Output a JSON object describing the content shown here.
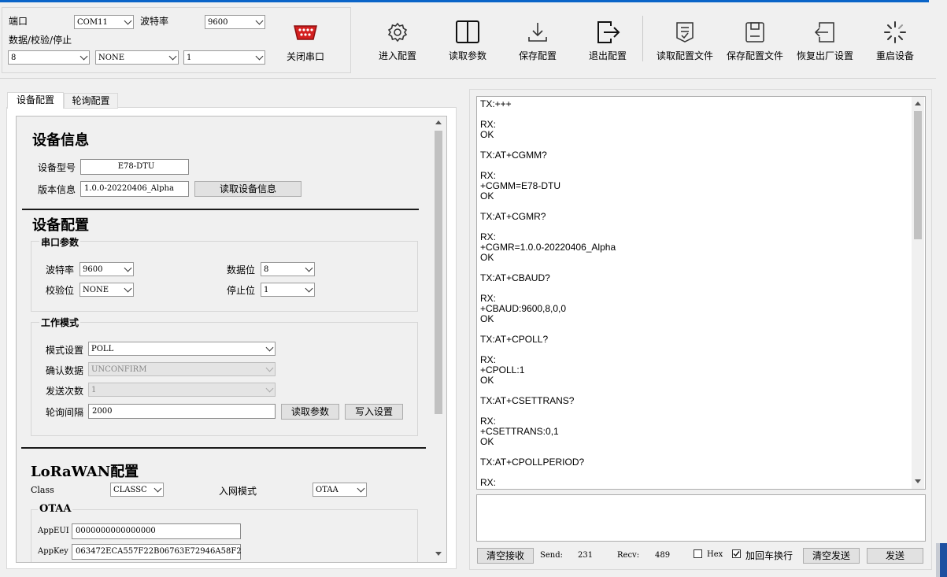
{
  "serial": {
    "port_label": "端口",
    "port_value": "COM11",
    "baud_label": "波特率",
    "baud_value": "9600",
    "dps_label": "数据/校验/停止",
    "data_value": "8",
    "parity_value": "NONE",
    "stop_value": "1",
    "close_label": "关闭串口"
  },
  "toolbar": {
    "enter_config": "进入配置",
    "read_params": "读取参数",
    "save_config": "保存配置",
    "exit_config": "退出配置",
    "read_config_file": "读取配置文件",
    "save_config_file": "保存配置文件",
    "factory_reset": "恢复出厂设置",
    "restart": "重启设备"
  },
  "tabs": {
    "device_config": "设备配置",
    "poll_config": "轮询配置"
  },
  "device_info": {
    "title": "设备信息",
    "model_label": "设备型号",
    "model_value": "E78-DTU",
    "version_label": "版本信息",
    "version_value": "1.0.0-20220406_Alpha",
    "read_info_button": "读取设备信息"
  },
  "device_config": {
    "title": "设备配置",
    "serial_params_title": "串口参数",
    "baud_label": "波特率",
    "baud_value": "9600",
    "databits_label": "数据位",
    "databits_value": "8",
    "parity_label": "校验位",
    "parity_value": "NONE",
    "stopbits_label": "停止位",
    "stopbits_value": "1",
    "work_mode_title": "工作模式",
    "mode_label": "模式设置",
    "mode_value": "POLL",
    "confirm_label": "确认数据",
    "confirm_value": "UNCONFIRM",
    "send_count_label": "发送次数",
    "send_count_value": "1",
    "poll_interval_label": "轮询间隔",
    "poll_interval_value": "2000",
    "read_params_button": "读取参数",
    "write_settings_button": "写入设置"
  },
  "lorawan": {
    "title": "LoRaWAN配置",
    "class_label": "Class",
    "class_value": "CLASSC",
    "join_label": "入网模式",
    "join_value": "OTAA",
    "otaa_title": "OTAA",
    "appeui_label": "AppEUI",
    "appeui_value": "0000000000000000",
    "appkey_label": "AppKey",
    "appkey_value": "063472ECA557F22B06763E72946A58F2"
  },
  "log_text": "TX:+++\n\nRX:\nOK\n\nTX:AT+CGMM?\n\nRX:\n+CGMM=E78-DTU\nOK\n\nTX:AT+CGMR?\n\nRX:\n+CGMR=1.0.0-20220406_Alpha\nOK\n\nTX:AT+CBAUD?\n\nRX:\n+CBAUD:9600,8,0,0\nOK\n\nTX:AT+CPOLL?\n\nRX:\n+CPOLL:1\nOK\n\nTX:AT+CSETTRANS?\n\nRX:\n+CSETTRANS:0,1\nOK\n\nTX:AT+CPOLLPERIOD?\n\nRX:",
  "bottom": {
    "clear_recv": "清空接收",
    "send_label": "Send:",
    "send_count": "231",
    "recv_label": "Recv:",
    "recv_count": "489",
    "hex_label": "Hex",
    "crlf_label": "加回车换行",
    "clear_send": "清空发送",
    "send_button": "发送"
  },
  "colors": {
    "accent": "#0a64c8",
    "serial_icon": "#d42020"
  }
}
